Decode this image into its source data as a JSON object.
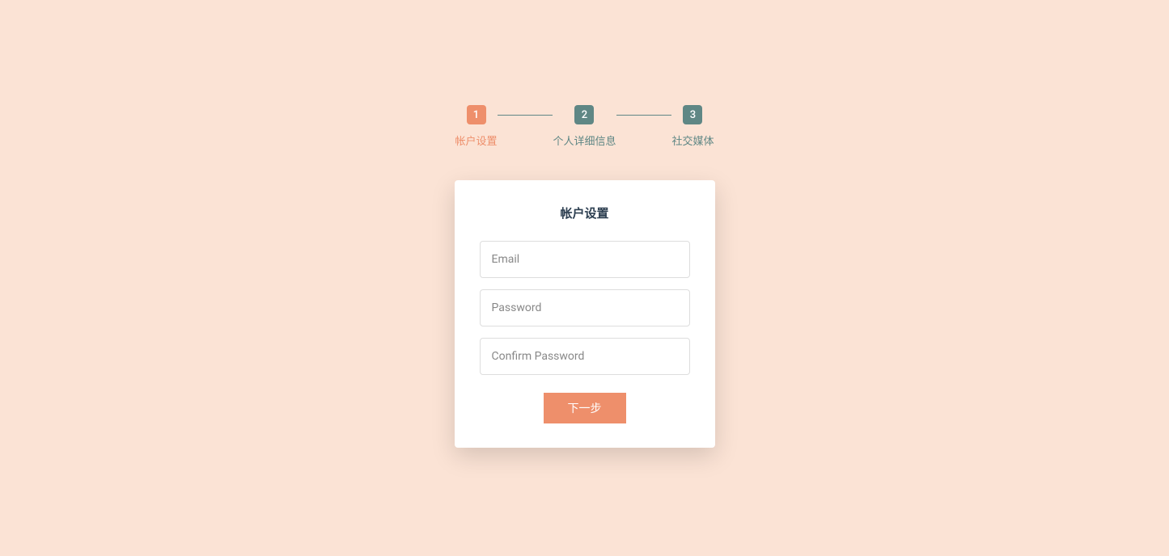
{
  "stepper": {
    "steps": [
      {
        "number": "1",
        "label": "帐户设置",
        "active": true
      },
      {
        "number": "2",
        "label": "个人详细信息",
        "active": false
      },
      {
        "number": "3",
        "label": "社交媒体",
        "active": false
      }
    ]
  },
  "form": {
    "title": "帐户设置",
    "fields": {
      "email": {
        "placeholder": "Email",
        "value": ""
      },
      "password": {
        "placeholder": "Password",
        "value": ""
      },
      "confirm_password": {
        "placeholder": "Confirm Password",
        "value": ""
      }
    },
    "next_button": "下一步"
  },
  "colors": {
    "background": "#fbe3d5",
    "accent": "#ee8f6b",
    "muted": "#5f8785"
  }
}
